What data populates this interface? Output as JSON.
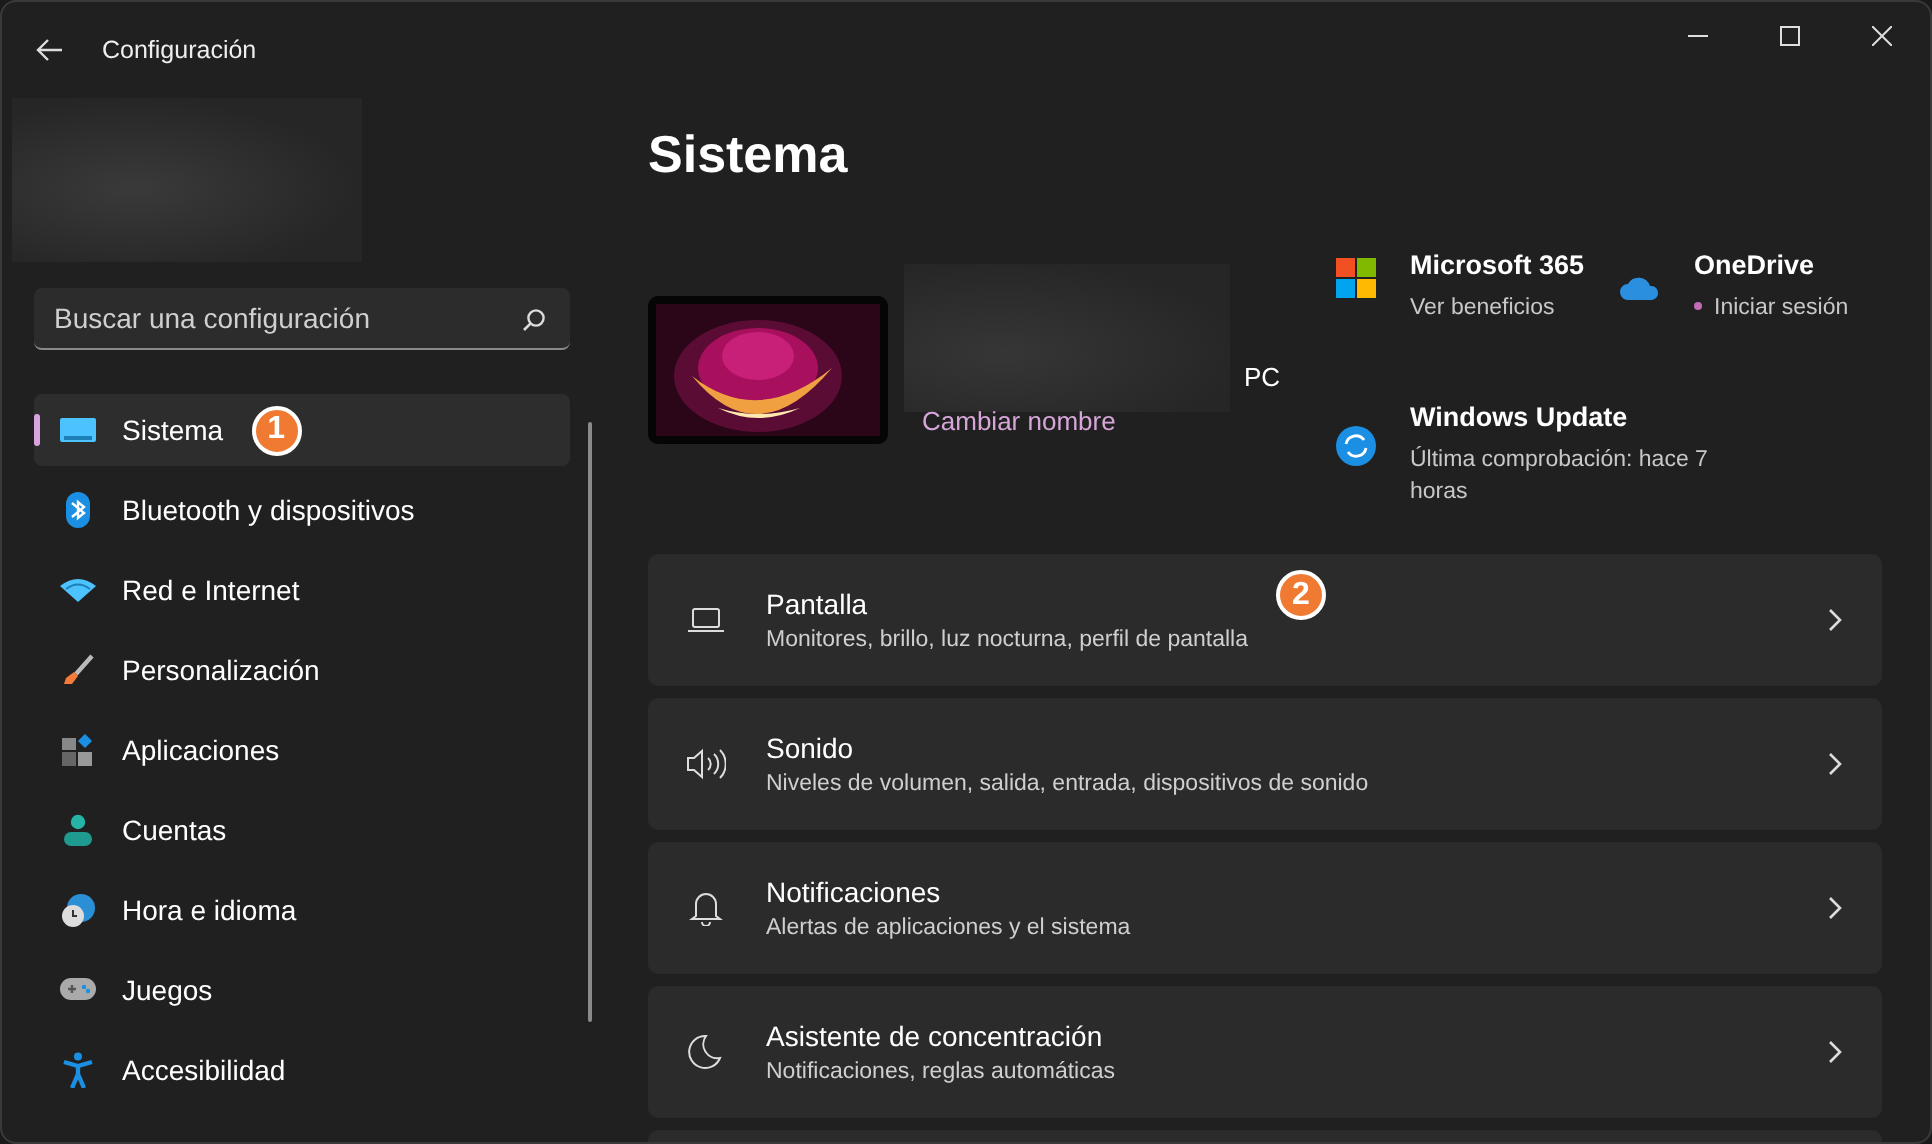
{
  "window": {
    "title": "Configuración"
  },
  "search": {
    "placeholder": "Buscar una configuración"
  },
  "sidebar": {
    "items": [
      {
        "label": "Sistema",
        "selected": true,
        "annotation": "1"
      },
      {
        "label": "Bluetooth y dispositivos",
        "selected": false
      },
      {
        "label": "Red e Internet",
        "selected": false
      },
      {
        "label": "Personalización",
        "selected": false
      },
      {
        "label": "Aplicaciones",
        "selected": false
      },
      {
        "label": "Cuentas",
        "selected": false
      },
      {
        "label": "Hora e idioma",
        "selected": false
      },
      {
        "label": "Juegos",
        "selected": false
      },
      {
        "label": "Accesibilidad",
        "selected": false
      }
    ]
  },
  "page": {
    "title": "Sistema",
    "device": {
      "name": "PC",
      "rename_link": "Cambiar nombre"
    },
    "tiles": [
      {
        "kind": "m365",
        "title": "Microsoft 365",
        "subtitle": "Ver beneficios"
      },
      {
        "kind": "onedrive",
        "title": "OneDrive",
        "subtitle": "Iniciar sesión",
        "dot": true
      },
      {
        "kind": "update",
        "title": "Windows Update",
        "subtitle": "Última comprobación: hace 7 horas"
      }
    ],
    "cards": [
      {
        "kind": "display",
        "title": "Pantalla",
        "subtitle": "Monitores, brillo, luz nocturna, perfil de pantalla",
        "annotation": "2"
      },
      {
        "kind": "sound",
        "title": "Sonido",
        "subtitle": "Niveles de volumen, salida, entrada, dispositivos de sonido"
      },
      {
        "kind": "notifications",
        "title": "Notificaciones",
        "subtitle": "Alertas de aplicaciones y el sistema"
      },
      {
        "kind": "focus",
        "title": "Asistente de concentración",
        "subtitle": "Notificaciones, reglas automáticas"
      }
    ]
  }
}
